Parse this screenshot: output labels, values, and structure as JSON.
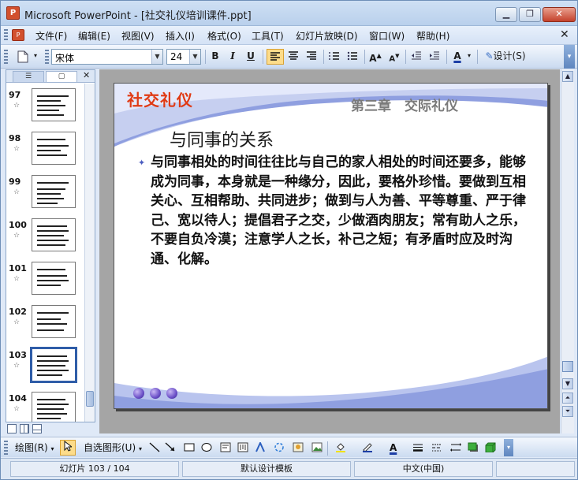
{
  "window": {
    "title": "Microsoft PowerPoint - [社交礼仪培训课件.ppt]",
    "app_icon_label": "P"
  },
  "menu": {
    "items": [
      "文件(F)",
      "编辑(E)",
      "视图(V)",
      "插入(I)",
      "格式(O)",
      "工具(T)",
      "幻灯片放映(D)",
      "窗口(W)",
      "帮助(H)"
    ]
  },
  "toolbar": {
    "font_name": "宋体",
    "font_size": "24",
    "bold": "B",
    "italic": "I",
    "underline": "U",
    "design_label": "设计(S)"
  },
  "thumbnails": [
    {
      "num": "97"
    },
    {
      "num": "98"
    },
    {
      "num": "99"
    },
    {
      "num": "100"
    },
    {
      "num": "101"
    },
    {
      "num": "102"
    },
    {
      "num": "103",
      "selected": true
    },
    {
      "num": "104"
    }
  ],
  "slide": {
    "logo": "社交礼仪",
    "chapter": "第三章　交际礼仪",
    "heading": "与同事的关系",
    "body": "与同事相处的时间往往比与自己的家人相处的时间还要多，能够成为同事，本身就是一种缘分，因此，要格外珍惜。要做到互相关心、互相帮助、共同进步；做到与人为善、平等尊重、严于律己、宽以待人；提倡君子之交，少做酒肉朋友；常有助人之乐，不要自负冷漠；注意学人之长，补己之短；有矛盾时应及时沟通、化解。",
    "theme_colors": {
      "logo": "#e03a14",
      "wave": "#b9c4ee",
      "accent": "#6a4fc7"
    }
  },
  "drawbar": {
    "draw_label": "绘图(R)",
    "autoshape_label": "自选图形(U)"
  },
  "status": {
    "slide_pos": "幻灯片 103 / 104",
    "template": "默认设计模板",
    "language": "中文(中国)"
  }
}
